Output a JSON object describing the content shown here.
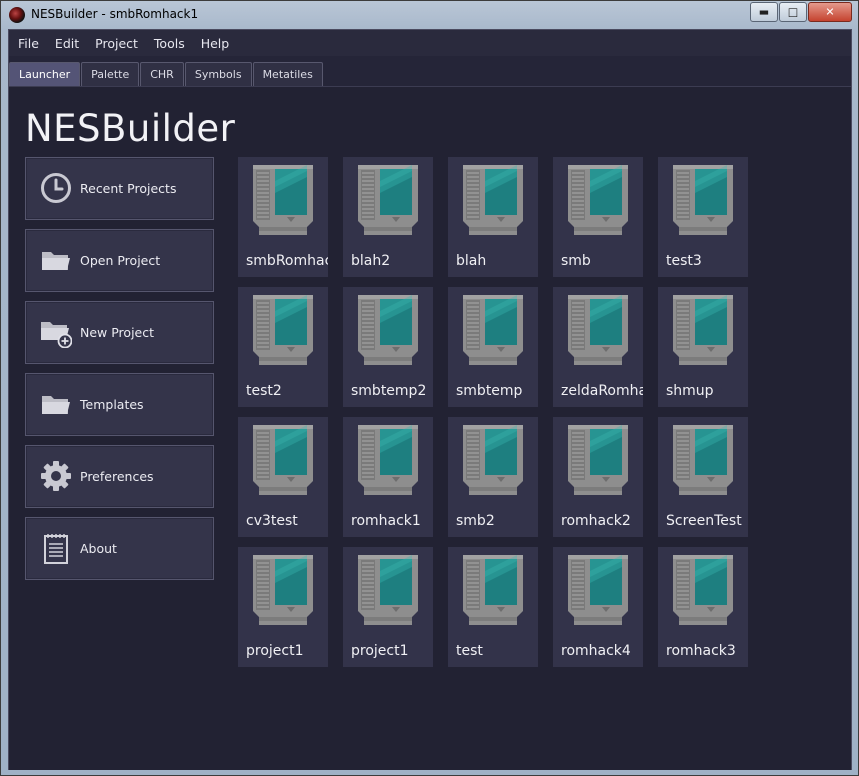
{
  "window": {
    "title": "NESBuilder - smbRomhack1"
  },
  "menu": [
    "File",
    "Edit",
    "Project",
    "Tools",
    "Help"
  ],
  "tabs": [
    {
      "label": "Launcher",
      "active": true
    },
    {
      "label": "Palette",
      "active": false
    },
    {
      "label": "CHR",
      "active": false
    },
    {
      "label": "Symbols",
      "active": false
    },
    {
      "label": "Metatiles",
      "active": false
    }
  ],
  "heading": "NESBuilder",
  "sidebar": [
    {
      "label": "Recent Projects",
      "icon": "clock-icon"
    },
    {
      "label": "Open Project",
      "icon": "folder-icon"
    },
    {
      "label": "New Project",
      "icon": "folder-add-icon"
    },
    {
      "label": "Templates",
      "icon": "folder-icon"
    },
    {
      "label": "Preferences",
      "icon": "gear-icon"
    },
    {
      "label": "About",
      "icon": "notepad-icon"
    }
  ],
  "projects": [
    "smbRomhac",
    "blah2",
    "blah",
    "smb",
    "test3",
    "test2",
    "smbtemp2",
    "smbtemp",
    "zeldaRomhac",
    "shmup",
    "cv3test",
    "romhack1",
    "smb2",
    "romhack2",
    "ScreenTest",
    "project1",
    "project1",
    "test",
    "romhack4",
    "romhack3"
  ],
  "colors": {
    "background": "#222233",
    "panel": "#33334a",
    "accent": "#545476",
    "cartridge": "#8c8c8c",
    "label": "#1e7f80"
  }
}
